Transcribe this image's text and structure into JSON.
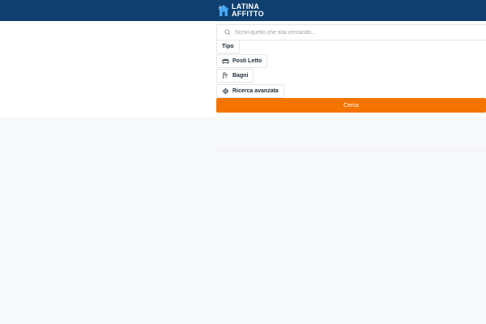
{
  "header": {
    "logo_line1": "LATINA",
    "logo_line2": "AFFITTO",
    "background_color": "#0e3f6f"
  },
  "search": {
    "placeholder": "Scrivi quello che stai cercando...",
    "icon": "search-icon"
  },
  "filters": {
    "tipo_label": "Tipo",
    "posti_letto_label": "Posti Letto",
    "posti_letto_icon": "bed-icon",
    "bagni_label": "Bagni",
    "bagni_icon": "shower-icon",
    "ricerca_avanzata_label": "Ricerca avanzata",
    "ricerca_avanzata_icon": "gear-icon"
  },
  "actions": {
    "cerca_label": "Cerca",
    "cerca_color": "#f57400"
  }
}
